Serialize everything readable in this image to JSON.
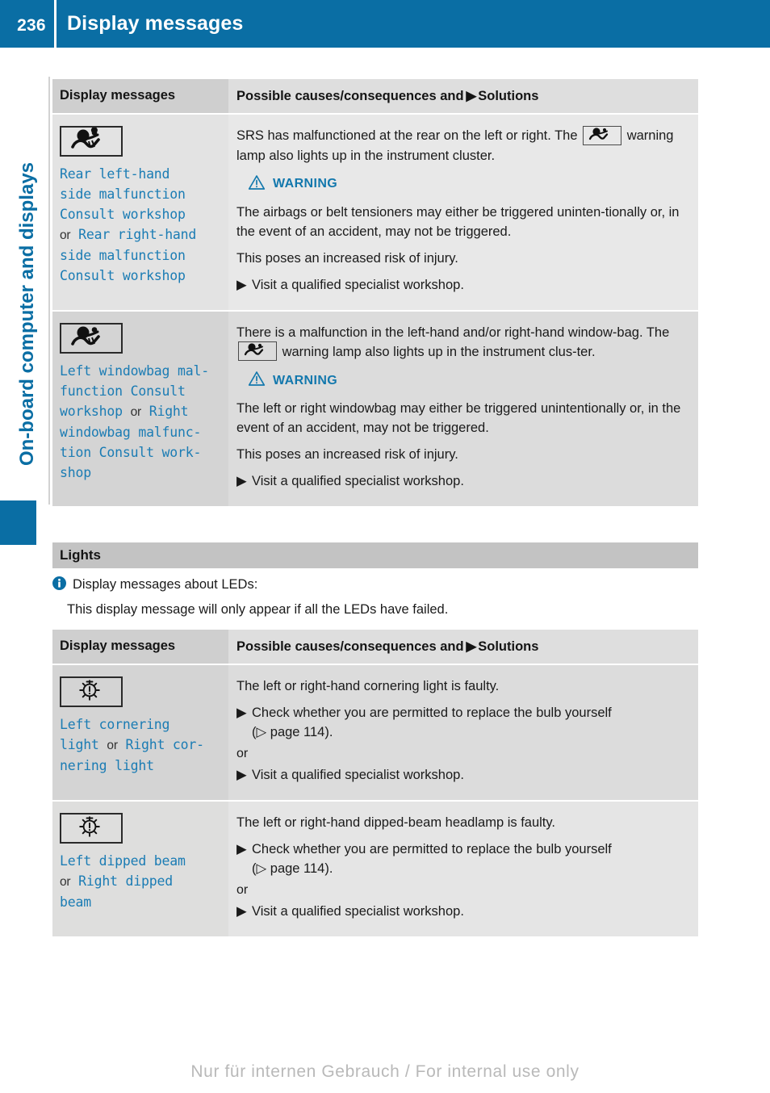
{
  "header": {
    "page_number": "236",
    "title": "Display messages"
  },
  "sidebar": {
    "chapter_label": "On-board computer and displays"
  },
  "table_headers": {
    "col1": "Display messages",
    "col2_before": "Possible causes/consequences and",
    "col2_after": "Solutions"
  },
  "table1": {
    "rows": [
      {
        "icon": "srs-airbag-icon",
        "message_line1": "Rear left-hand",
        "message_line2": "side malfunction",
        "message_line3": "Consult workshop",
        "or_word": "or",
        "message_line4": "Rear right-hand",
        "message_line5": "side malfunction",
        "message_line6": "Consult workshop",
        "intro_part1": "SRS has malfunctioned at the rear on the left or right. The",
        "intro_part2": "warning lamp also lights up in the instrument cluster.",
        "warning_label": "WARNING",
        "warning_body1": "The airbags or belt tensioners may either be triggered uninten-tionally or, in the event of an accident, may not be triggered.",
        "warning_body2": "This poses an increased risk of injury.",
        "solution": "Visit a qualified specialist workshop."
      },
      {
        "icon": "srs-airbag-icon",
        "message_line1": "Left windowbag mal-",
        "message_line2": "function Consult",
        "message_line3": "workshop",
        "or_word": "or",
        "message_line4": "Right",
        "message_line5": "windowbag malfunc-",
        "message_line6": "tion Consult work-",
        "message_line7": "shop",
        "intro_part1": "There is a malfunction in the left-hand and/or right-hand window-bag. The",
        "intro_part2": "warning lamp also lights up in the instrument clus-ter.",
        "warning_label": "WARNING",
        "warning_body1": "The left or right windowbag may either be triggered unintentionally or, in the event of an accident, may not be triggered.",
        "warning_body2": "This poses an increased risk of injury.",
        "solution": "Visit a qualified specialist workshop."
      }
    ]
  },
  "lights_section": {
    "heading": "Lights",
    "note_line1": "Display messages about LEDs:",
    "note_line2": "This display message will only appear if all the LEDs have failed."
  },
  "table2": {
    "rows": [
      {
        "icon": "bulb-warning-icon",
        "message_line1": "Left cornering",
        "message_line2": "light",
        "or_word": "or",
        "message_line3": "Right cor-",
        "message_line4": "nering light",
        "cause": "The left or right-hand cornering light is faulty.",
        "solution1": "Check whether you are permitted to replace the bulb yourself",
        "solution1_ref": "(▷ page 114).",
        "or_word2": "or",
        "solution2": "Visit a qualified specialist workshop."
      },
      {
        "icon": "bulb-warning-icon",
        "message_line1": "Left dipped beam",
        "or_word": "or",
        "message_line2": "Right dipped",
        "message_line3": "beam",
        "cause": "The left or right-hand dipped-beam headlamp is faulty.",
        "solution1": "Check whether you are permitted to replace the bulb yourself",
        "solution1_ref": "(▷ page 114).",
        "or_word2": "or",
        "solution2": "Visit a qualified specialist workshop."
      }
    ]
  },
  "footer": {
    "watermark": "Nur für internen Gebrauch / For internal use only"
  },
  "colors": {
    "brand_blue": "#0a6ea4",
    "message_blue": "#1b7cb4",
    "warning_blue": "#1378ad"
  }
}
